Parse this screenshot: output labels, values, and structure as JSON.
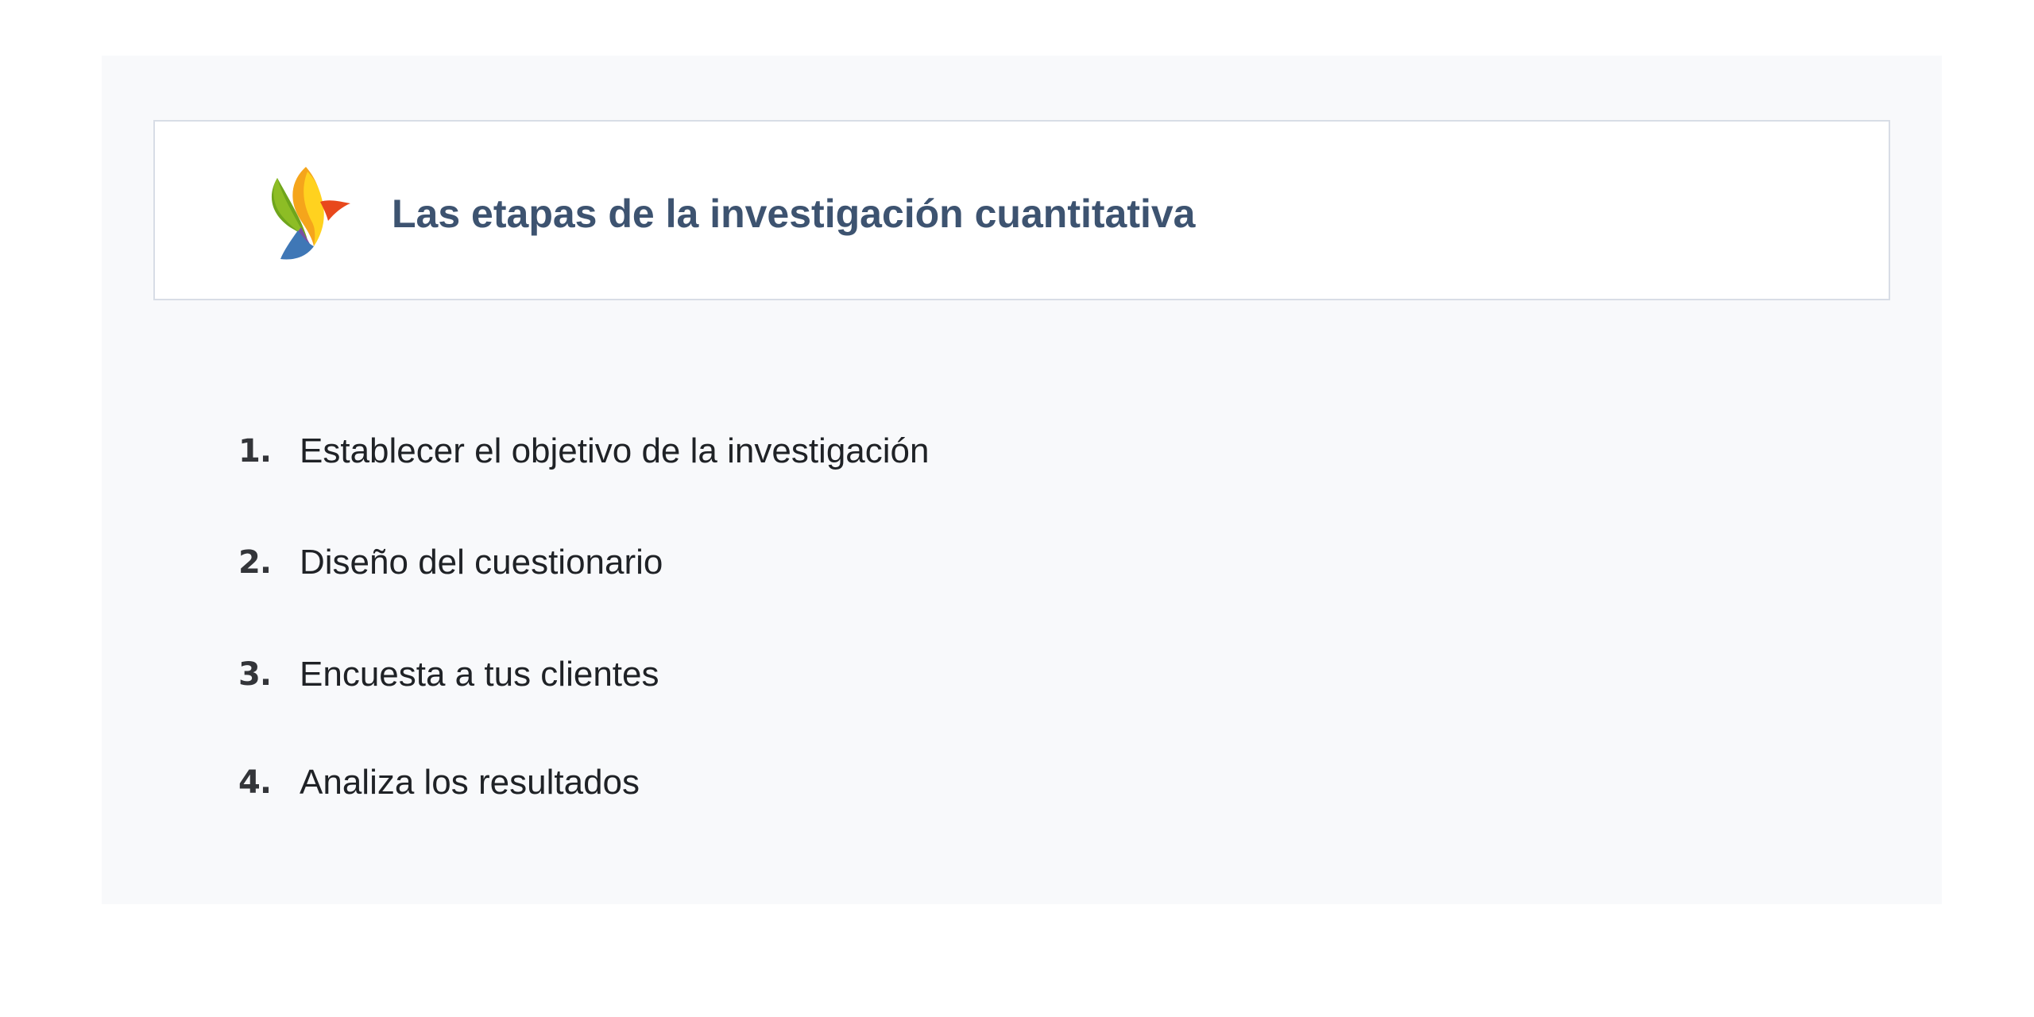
{
  "header": {
    "title": "Las etapas de la investigación cuantitativa",
    "logo": "multicolor-bird-logo-icon"
  },
  "steps": [
    {
      "number": "1.",
      "text": "Establecer el objetivo de la investigación"
    },
    {
      "number": "2.",
      "text": "Diseño del cuestionario"
    },
    {
      "number": "3.",
      "text": "Encuesta a tus clientes"
    },
    {
      "number": "4.",
      "text": "Analiza los resultados"
    }
  ],
  "colors": {
    "title": "#3d5370",
    "panel_background": "#f8f9fb",
    "card_border": "#d8dde6",
    "step_text": "#1f2226"
  }
}
